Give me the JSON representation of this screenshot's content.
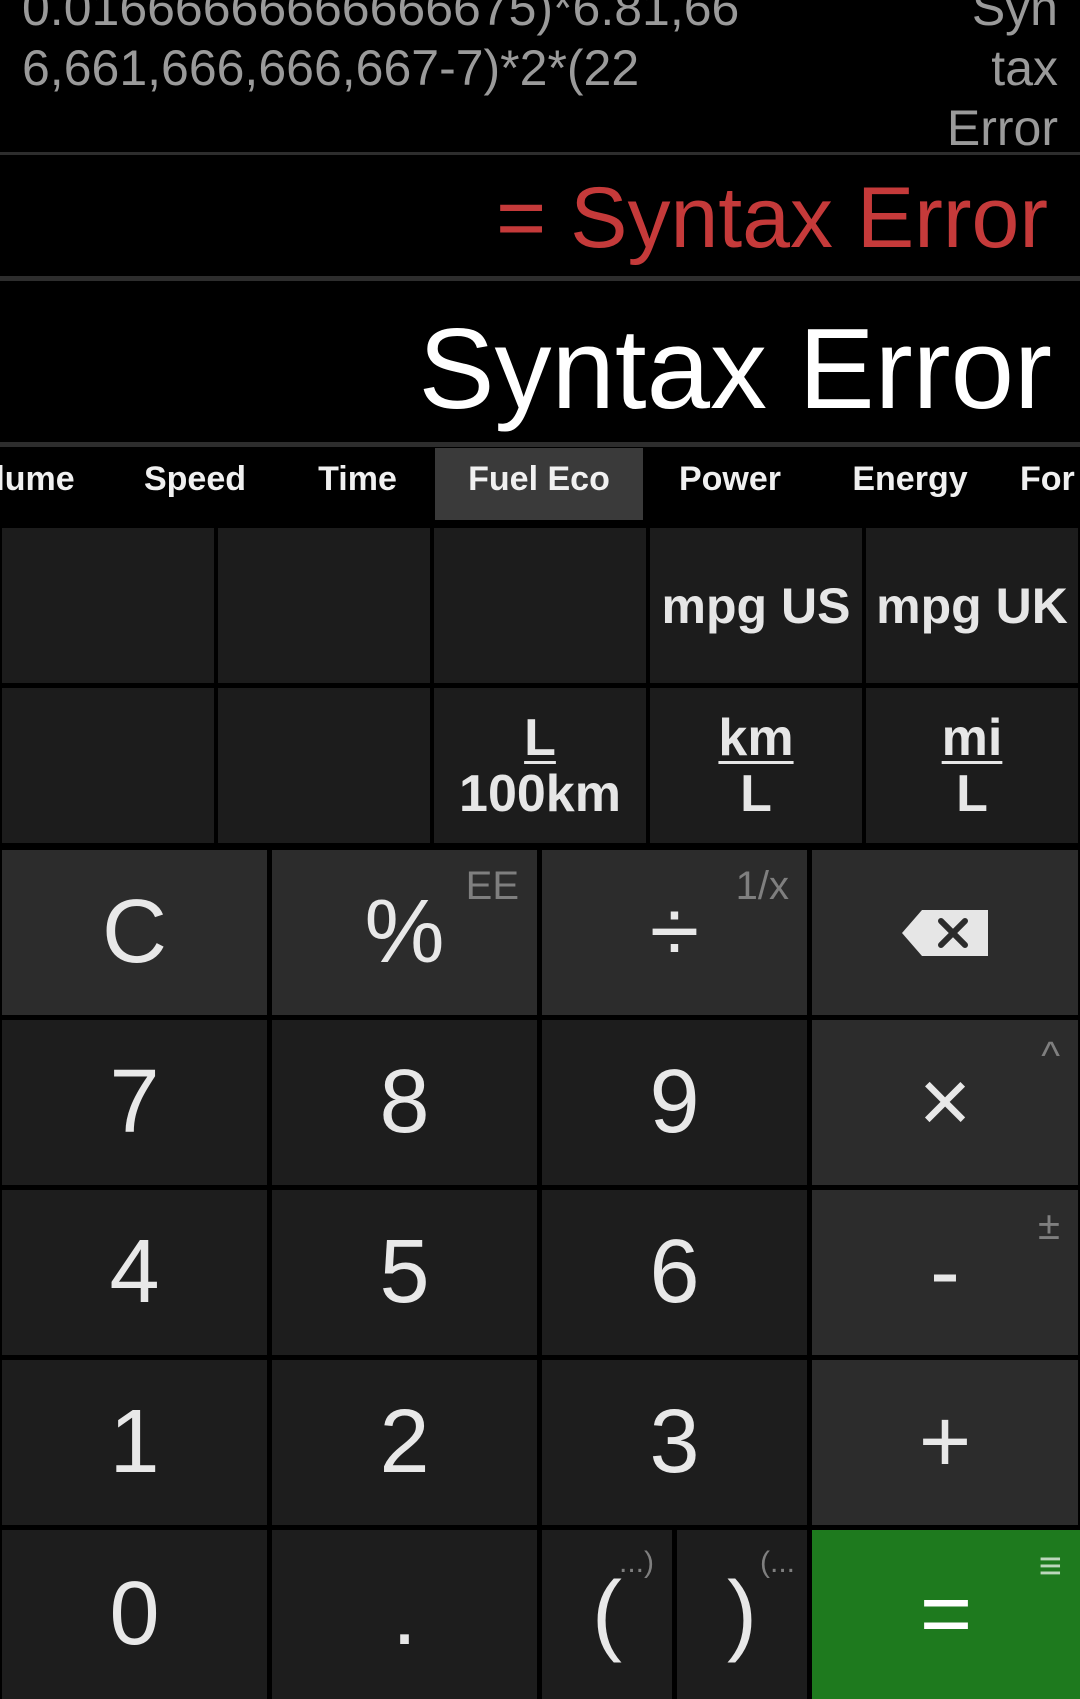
{
  "history": {
    "expression_line1": "0.01666666666666675)*6.81,66",
    "expression_line2": "6,661,666,666,667-7)*2*(22",
    "result_lines": [
      "Syn",
      "tax",
      "Error"
    ]
  },
  "live_result": "= Syntax Error",
  "display": "Syntax Error",
  "tabs": [
    {
      "label": "lume"
    },
    {
      "label": "Speed"
    },
    {
      "label": "Time"
    },
    {
      "label": "Fuel Eco"
    },
    {
      "label": "Power"
    },
    {
      "label": "Energy"
    },
    {
      "label": "For"
    }
  ],
  "active_tab": "Fuel Eco",
  "units": {
    "mpg_us": "mpg US",
    "mpg_uk": "mpg UK",
    "l_per_100km": {
      "num": "L",
      "den": "100km"
    },
    "km_per_l": {
      "num": "km",
      "den": "L"
    },
    "mi_per_l": {
      "num": "mi",
      "den": "L"
    }
  },
  "keys": {
    "clear": "C",
    "percent": "%",
    "percent_secondary": "EE",
    "divide": "÷",
    "divide_secondary": "1/x",
    "backspace_icon": "backspace-icon",
    "seven": "7",
    "eight": "8",
    "nine": "9",
    "multiply": "×",
    "multiply_secondary": "^",
    "four": "4",
    "five": "5",
    "six": "6",
    "minus": "-",
    "minus_secondary": "±",
    "one": "1",
    "two": "2",
    "three": "3",
    "plus": "+",
    "zero": "0",
    "decimal": ".",
    "open_paren": "(",
    "open_paren_secondary": "...)",
    "close_paren": ")",
    "close_paren_secondary": "(...",
    "equals": "=",
    "equals_secondary": "≡"
  },
  "colors": {
    "error": "#c53a3a",
    "equals_bg": "#1e7a1e",
    "key_bg": "#1d1d1d",
    "function_key_bg": "#2c2c2c"
  }
}
